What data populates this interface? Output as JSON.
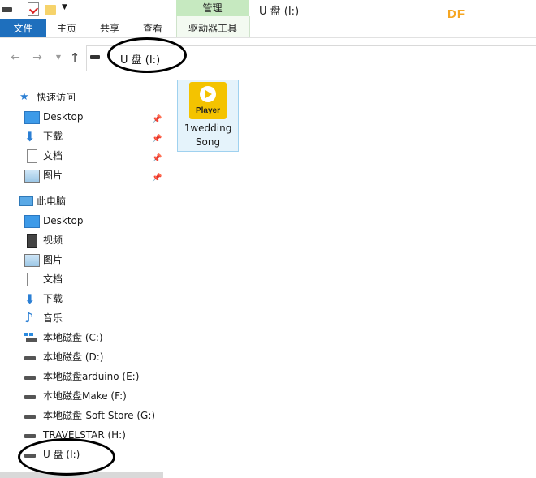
{
  "title_bar": {
    "manage_tab": "管理",
    "window_title": "U 盘 (I:)",
    "watermark": "DF"
  },
  "ribbon": {
    "tabs": [
      "文件",
      "主页",
      "共享",
      "查看",
      "驱动器工具"
    ]
  },
  "address": {
    "path": "U 盘 (I:)"
  },
  "sidebar": {
    "quick_access": {
      "label": "快速访问",
      "items": [
        {
          "label": "Desktop",
          "icon": "desktop-icon",
          "pinned": true
        },
        {
          "label": "下载",
          "icon": "download-icon",
          "pinned": true
        },
        {
          "label": "文档",
          "icon": "document-icon",
          "pinned": true
        },
        {
          "label": "图片",
          "icon": "picture-icon",
          "pinned": true
        }
      ]
    },
    "this_pc": {
      "label": "此电脑",
      "items": [
        {
          "label": "Desktop",
          "icon": "desktop-icon"
        },
        {
          "label": "视频",
          "icon": "video-icon"
        },
        {
          "label": "图片",
          "icon": "picture-icon"
        },
        {
          "label": "文档",
          "icon": "document-icon"
        },
        {
          "label": "下载",
          "icon": "download-icon"
        },
        {
          "label": "音乐",
          "icon": "music-icon"
        },
        {
          "label": "本地磁盘 (C:)",
          "icon": "windows-drive-icon"
        },
        {
          "label": "本地磁盘 (D:)",
          "icon": "drive-icon"
        },
        {
          "label": "本地磁盘arduino (E:)",
          "icon": "drive-icon"
        },
        {
          "label": "本地磁盘Make (F:)",
          "icon": "drive-icon"
        },
        {
          "label": "本地磁盘-Soft Store (G:)",
          "icon": "drive-icon"
        },
        {
          "label": "TRAVELSTAR (H:)",
          "icon": "drive-icon"
        },
        {
          "label": "U 盘 (I:)",
          "icon": "usb-drive-icon"
        }
      ]
    }
  },
  "files": [
    {
      "name": "1wedding Song",
      "icon_label": "Player",
      "icon": "player-icon"
    }
  ],
  "colors": {
    "accent": "#1e6fbd",
    "manage_tab": "#c6e9c0",
    "player_icon": "#f4c300",
    "selection": "#e5f3fb"
  }
}
